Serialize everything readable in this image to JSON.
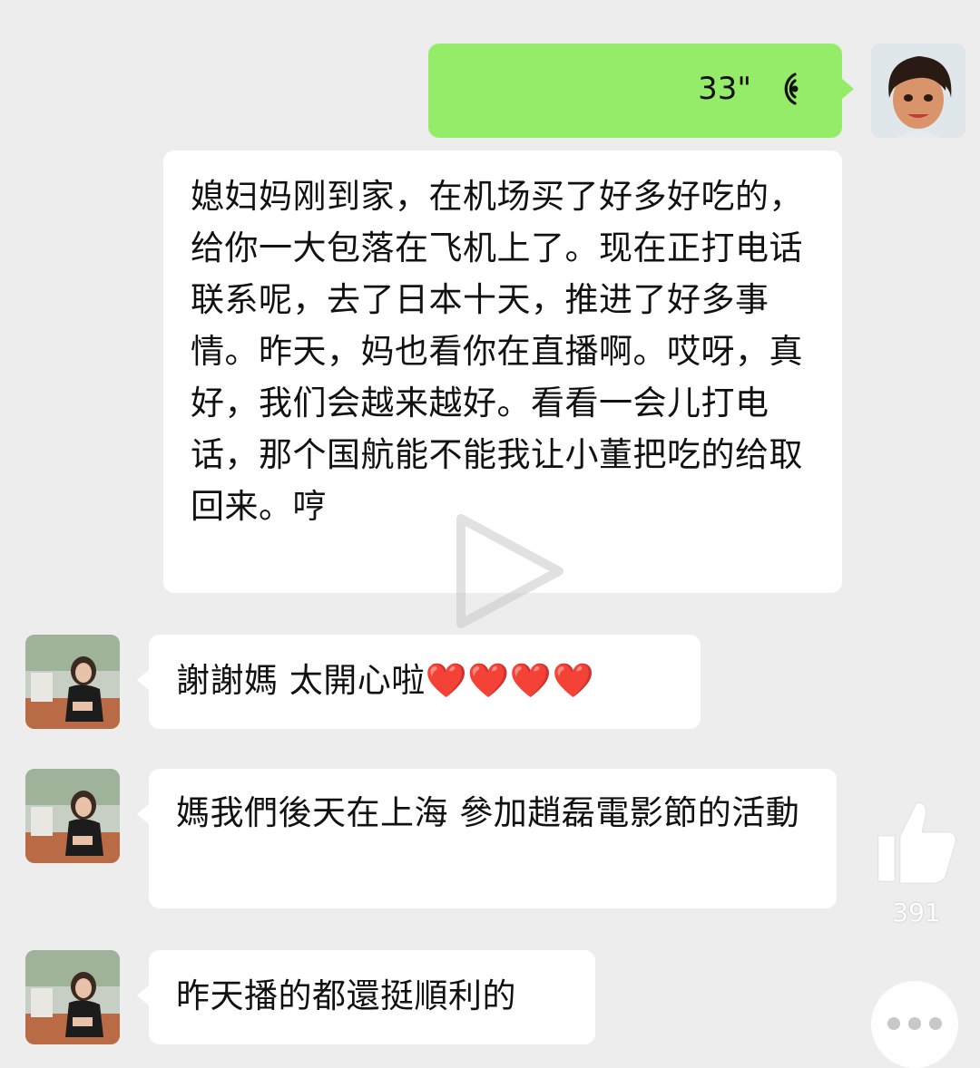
{
  "messages": {
    "voice": {
      "duration": "33\"",
      "icon": "voice-wave-icon"
    },
    "long_text": "媳妇妈刚到家，在机场买了好多好吃的，给你一大包落在飞机上了。现在正打电话联系呢，去了日本十天，推进了好多事情。昨天，妈也看你在直播啊。哎呀，真好，我们会越来越好。看看一会儿打电话，那个国航能不能我让小董把吃的给取回来。哼",
    "reply1": "謝謝媽 太開心啦",
    "reply1_emoji": "❤️❤️❤️❤️",
    "reply2": "媽我們後天在上海 參加趙磊電影節的活動",
    "reply3": "昨天播的都還挺順利的"
  },
  "overlay": {
    "play_icon": "play-icon",
    "like_icon": "thumbs-up-icon",
    "like_count": "391",
    "more_icon": "more-dots-icon"
  },
  "colors": {
    "background": "#ededed",
    "sent_bubble": "#95ec69",
    "received_bubble": "#ffffff",
    "heart": "#e0292e"
  }
}
